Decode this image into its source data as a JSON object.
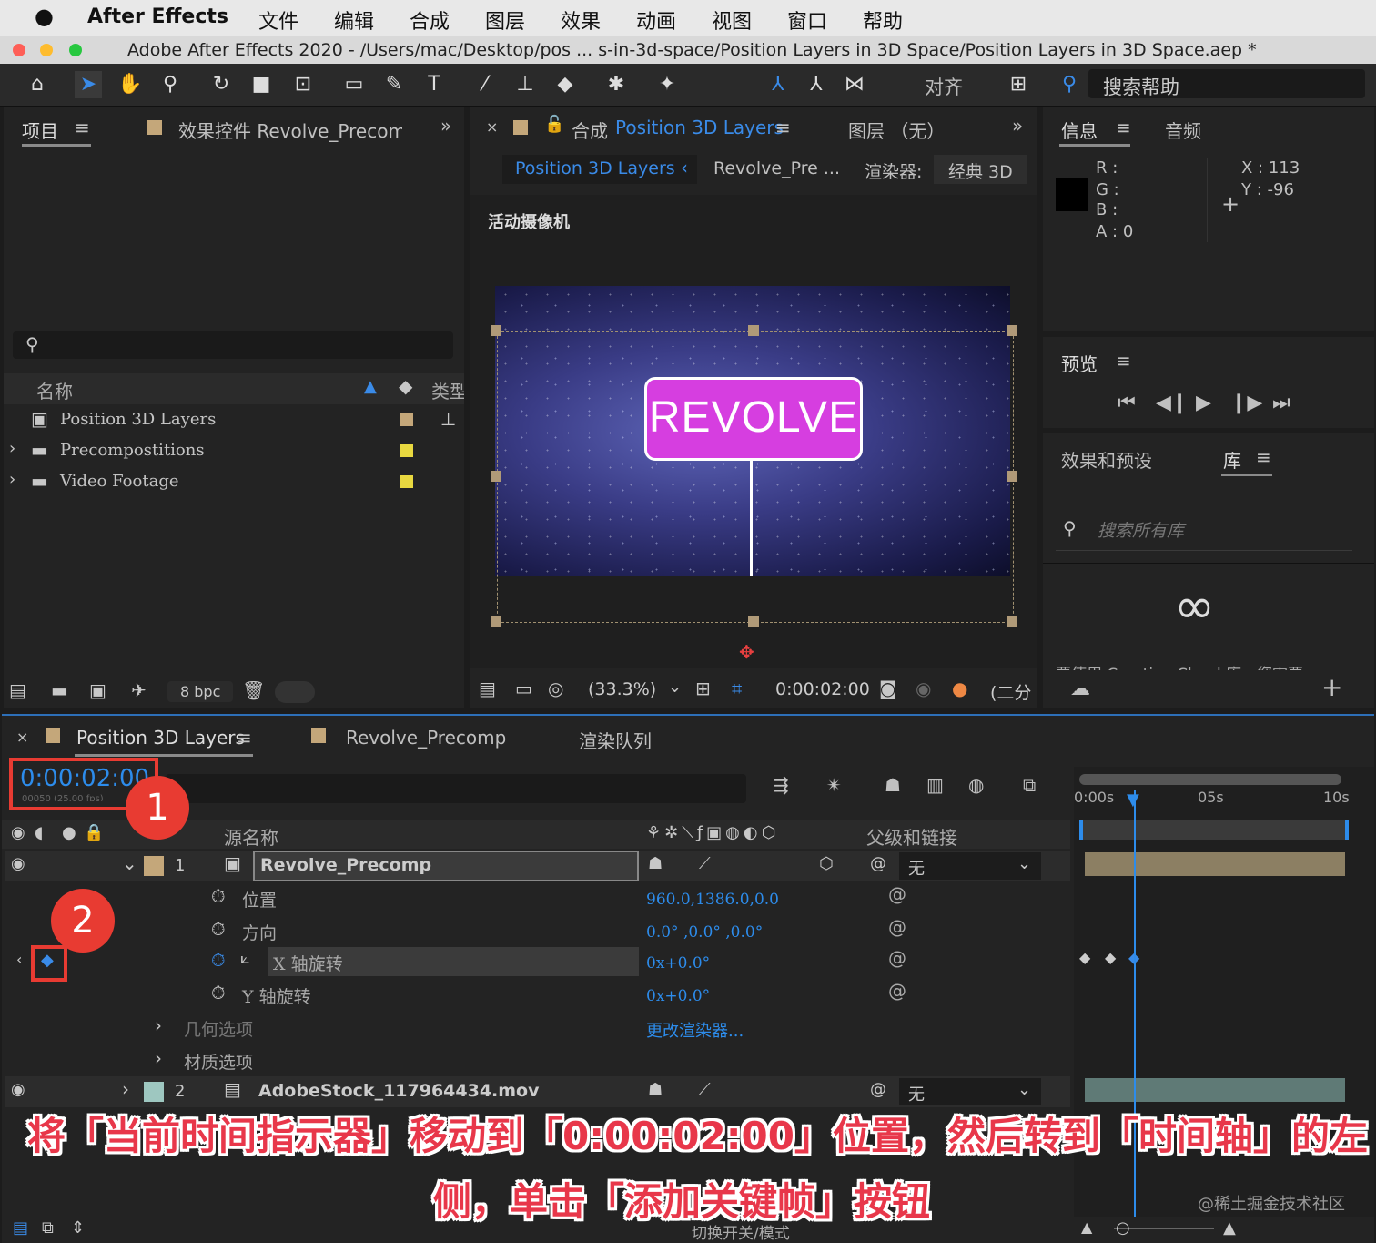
{
  "menubar": {
    "app": "After Effects",
    "items": [
      "文件",
      "编辑",
      "合成",
      "图层",
      "效果",
      "动画",
      "视图",
      "窗口",
      "帮助"
    ]
  },
  "window": {
    "title": "Adobe After Effects 2020 - /Users/mac/Desktop/pos ... s-in-3d-space/Position Layers in 3D Space/Position Layers in 3D Space.aep *"
  },
  "toolbar": {
    "align_label": "对齐",
    "search_help": "搜索帮助"
  },
  "project": {
    "tab": "项目",
    "effects_tab": "效果控件 Revolve_Precomp",
    "col_name": "名称",
    "col_type": "类型",
    "items": [
      {
        "name": "Position 3D Layers",
        "color": "#c4a77a"
      },
      {
        "name": "Precompostitions",
        "color": "#e8d840"
      },
      {
        "name": "Video Footage",
        "color": "#e8d840"
      }
    ],
    "bpc": "8 bpc"
  },
  "comp": {
    "tab_prefix": "合成",
    "tab_name": "Position 3D Layers",
    "layer_tab": "图层 （无）",
    "breadcrumb1": "Position 3D Layers",
    "breadcrumb2": "Revolve_Pre ...",
    "renderer_label": "渲染器:",
    "renderer_value": "经典 3D",
    "camera_label": "活动摄像机",
    "sign_text": "REVOLVE",
    "zoom": "(33.3%)",
    "timecode": "0:00:02:00",
    "resolution": "(二分"
  },
  "info": {
    "tab": "信息",
    "audio_tab": "音频",
    "r": "R :",
    "g": "G :",
    "b": "B :",
    "a": "A : 0",
    "x": "X : 113",
    "y": "Y : -96"
  },
  "preview": {
    "tab": "预览"
  },
  "effects": {
    "tab": "效果和预设",
    "lib_tab": "库",
    "search_placeholder": "搜索所有库",
    "cut_text": "要使用 Creative Cloud 库，您需要"
  },
  "timeline": {
    "tab1": "Position 3D Layers",
    "tab2": "Revolve_Precomp",
    "tab3": "渲染队列",
    "current_time": "0:00:02:00",
    "frames_sub": "00050 (25.00 fps)",
    "col_source": "源名称",
    "col_parent": "父级和链接",
    "ruler": [
      "0:00s",
      "05s",
      "10s"
    ],
    "layers": [
      {
        "num": "1",
        "name": "Revolve_Precomp",
        "parent": "无"
      },
      {
        "num": "2",
        "name": "AdobeStock_117964434.mov",
        "parent": "无"
      }
    ],
    "props": [
      {
        "name": "位置",
        "value": "960.0,1386.0,0.0"
      },
      {
        "name": "方向",
        "value": "0.0° ,0.0° ,0.0°"
      },
      {
        "name": "X 轴旋转",
        "value": "0x+0.0°"
      },
      {
        "name": "Y 轴旋转",
        "value": "0x+0.0°"
      }
    ],
    "geometry": "几何选项",
    "geometry_value": "更改渲染器...",
    "material": "材质选项",
    "footer": "切换开关/模式"
  },
  "annotations": {
    "badge1": "1",
    "badge2": "2",
    "line1": "将「当前时间指示器」移动到「0:00:02:00」位置，然后转到「时间轴」的左",
    "line2": "侧，单击「添加关键帧」按钮",
    "watermark": "@稀土掘金技术社区"
  },
  "colors": {
    "accent": "#2d8ceb",
    "annotation": "#e8374a",
    "sign": "#d63ee0"
  }
}
